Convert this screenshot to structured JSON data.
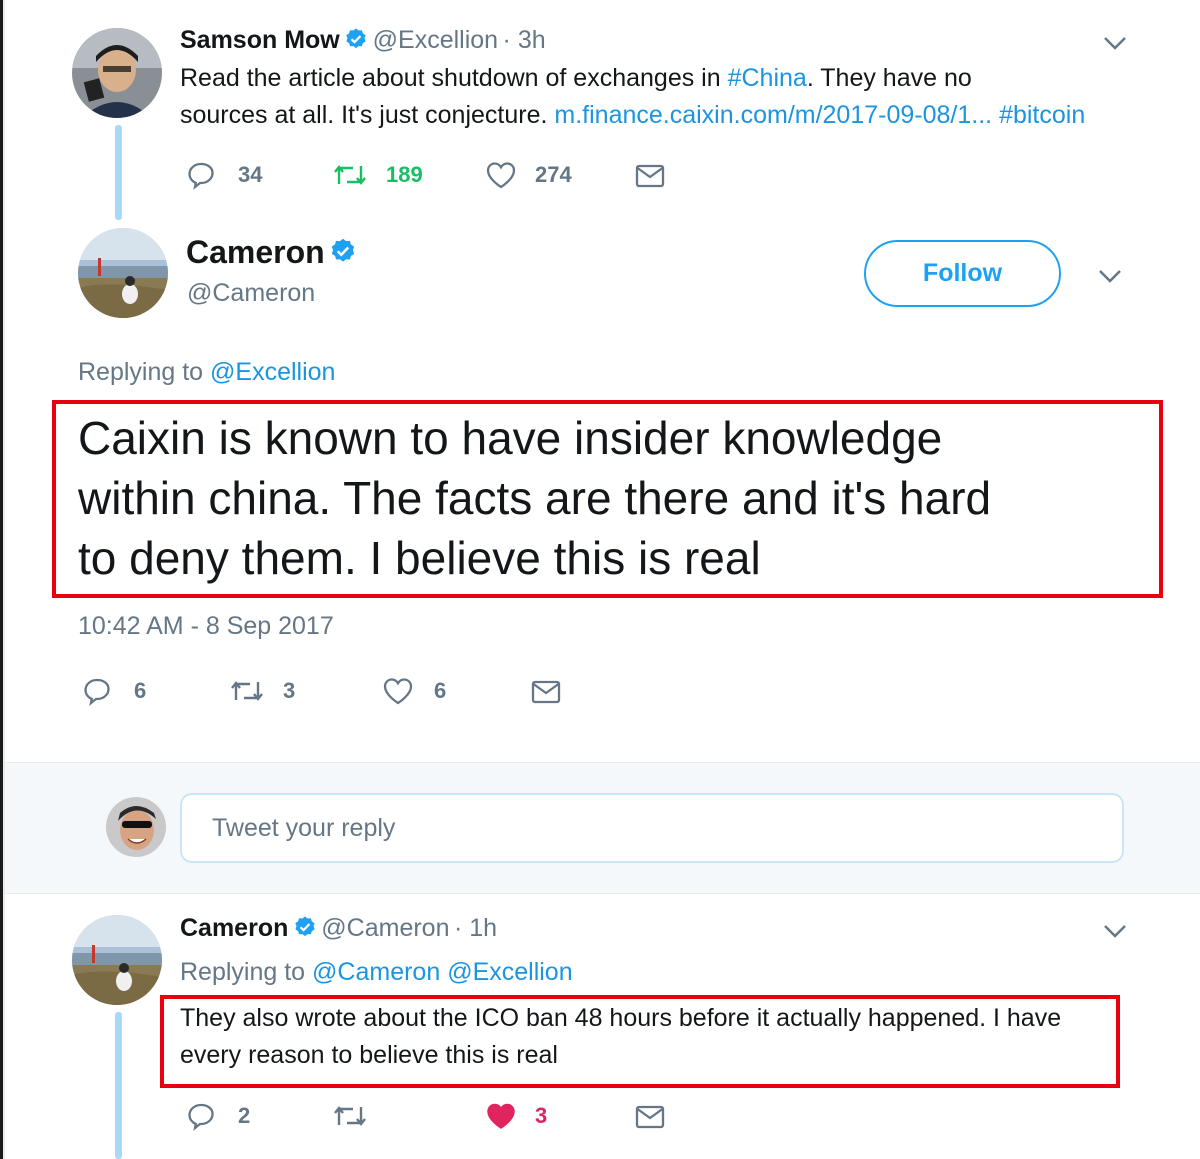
{
  "tweet1": {
    "name": "Samson Mow",
    "handle": "@Excellion",
    "age": "3h",
    "text_1": "Read the article about shutdown of exchanges in ",
    "hashtag_china": "#China",
    "text_2": ". They have no",
    "text_3": "sources at all. It's just conjecture. ",
    "link": "m.finance.caixin.com/m/2017-09-08/1...",
    "hashtag_bitcoin": "#bitcoin",
    "replies": "34",
    "retweets": "189",
    "likes": "274"
  },
  "tweet2": {
    "name": "Cameron",
    "handle": "@Cameron",
    "follow_label": "Follow",
    "replying_prefix": "Replying to ",
    "replying_handle": "@Excellion",
    "text_line1": "Caixin is known to have insider knowledge",
    "text_line2": "within china. The facts are there and it's hard",
    "text_line3": "to deny them. I believe this is real",
    "timestamp": "10:42 AM - 8 Sep 2017",
    "replies": "6",
    "retweets": "3",
    "likes": "6"
  },
  "reply_box": {
    "placeholder": "Tweet your reply"
  },
  "tweet3": {
    "name": "Cameron",
    "handle": "@Cameron",
    "age": "1h",
    "replying_prefix": "Replying to ",
    "replying_handle_1": "@Cameron",
    "replying_handle_2": "@Excellion",
    "text_line1": "They also wrote about the ICO ban 48 hours before it actually happened. I have",
    "text_line2": "every reason to believe this is real",
    "replies": "2",
    "likes": "3"
  },
  "colors": {
    "link": "#1b95e0",
    "retweet_active": "#17bf63",
    "like_active": "#e0245e",
    "highlight_box": "#e8000f"
  },
  "icons": [
    "verified-badge-icon",
    "chevron-down-icon",
    "reply-icon",
    "retweet-icon",
    "like-icon",
    "like-filled-icon",
    "direct-message-icon"
  ]
}
